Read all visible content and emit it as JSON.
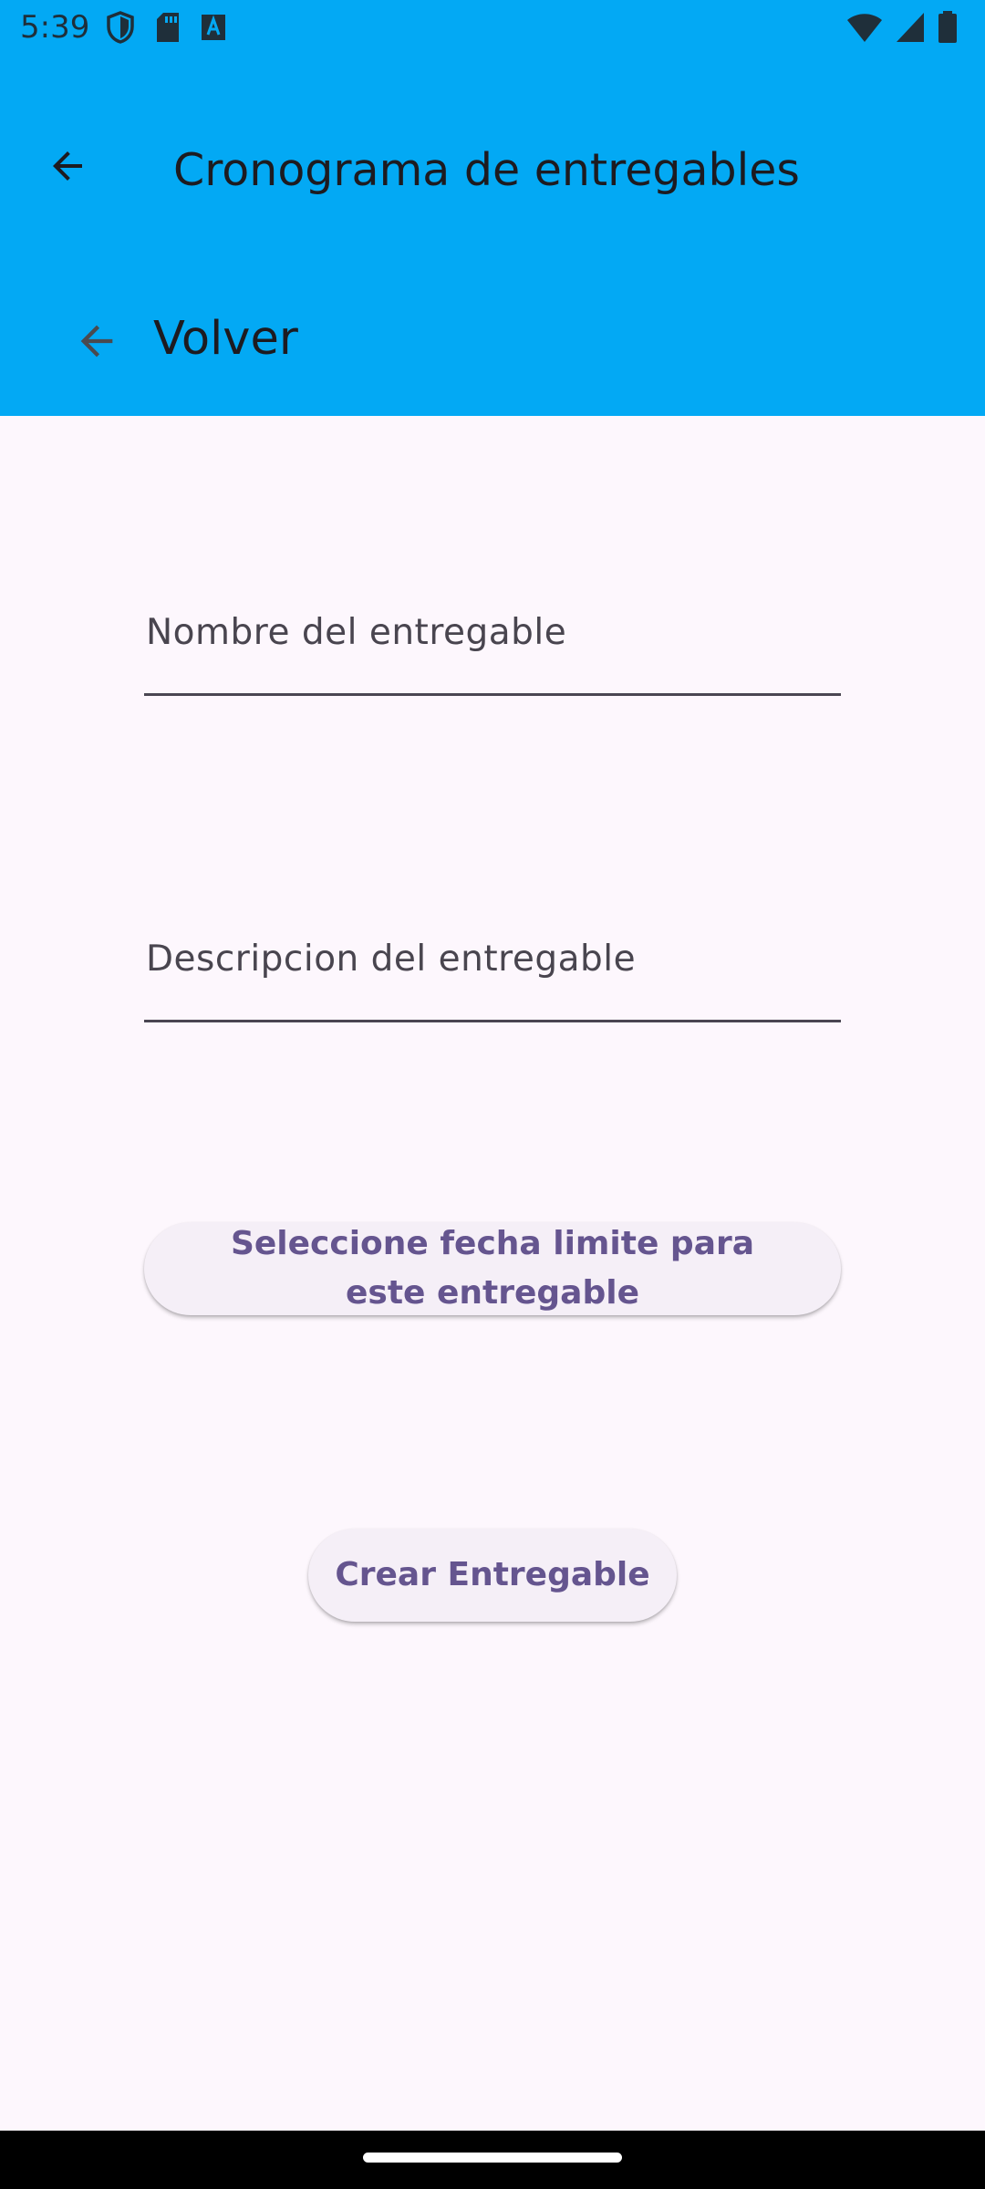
{
  "status_bar": {
    "time": "5:39",
    "left_icons": [
      "shield-icon",
      "sd-card-icon",
      "font-a-icon"
    ],
    "right_icons": [
      "wifi-icon",
      "signal-icon",
      "battery-icon"
    ]
  },
  "app_bar": {
    "title": "Cronograma de entregables",
    "back_icon": "arrow-back-icon"
  },
  "volver": {
    "label": "Volver",
    "icon": "arrow-back-icon"
  },
  "form": {
    "nombre_label": "Nombre del entregable",
    "nombre_value": "",
    "descripcion_label": "Descripcion del entregable",
    "descripcion_value": "",
    "fecha_button": "Seleccione fecha limite para este entregable",
    "crear_button": "Crear Entregable"
  },
  "colors": {
    "header_background": "#03a9f4",
    "page_background": "#fdf7fd",
    "button_background": "#f5eff7",
    "button_text": "#65558f",
    "field_underline": "#4a4652"
  }
}
